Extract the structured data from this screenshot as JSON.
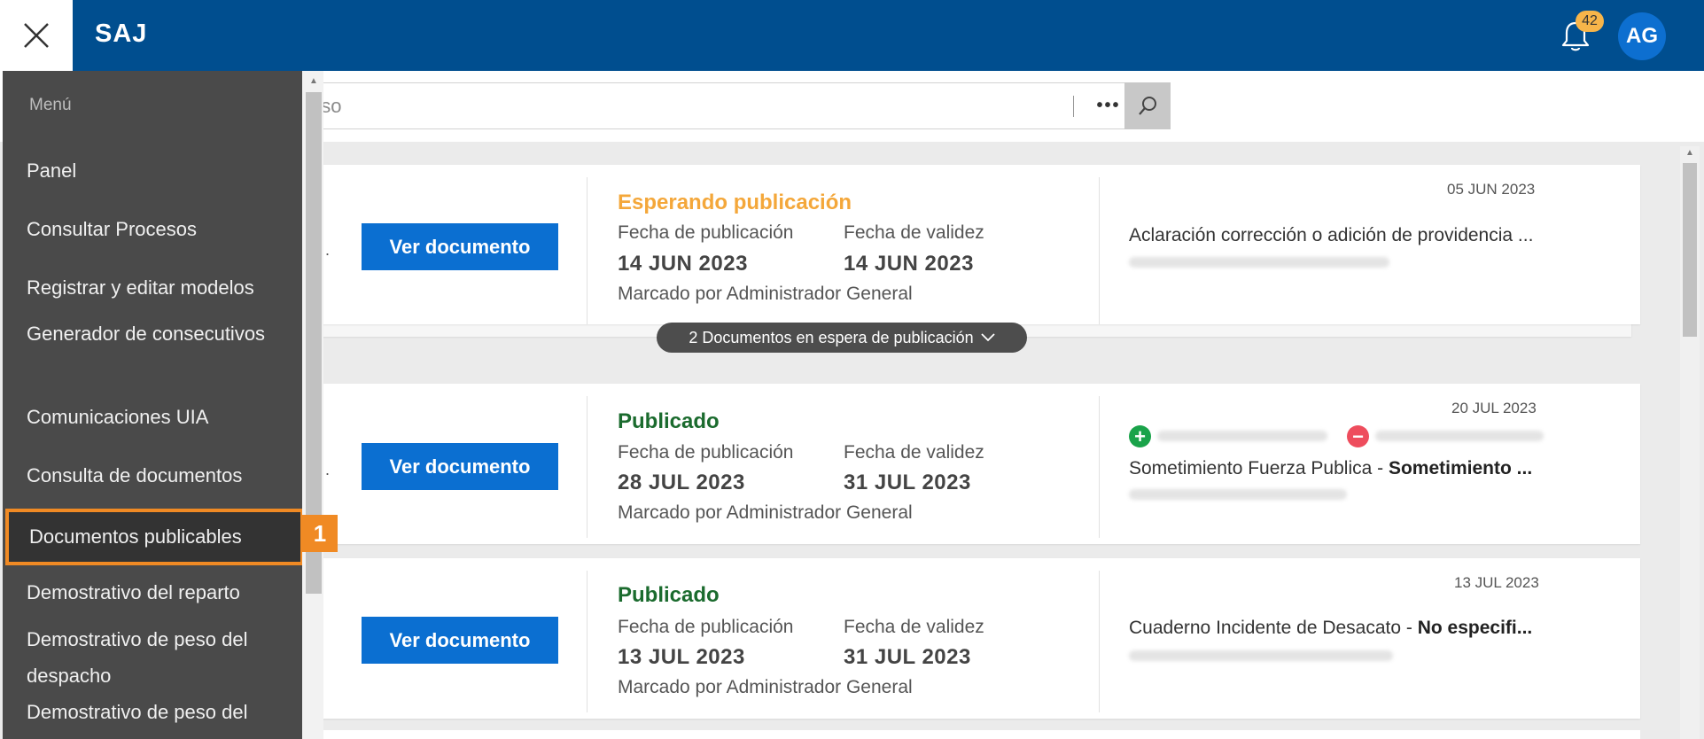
{
  "header": {
    "brand": "SAJ",
    "notifications_count": "42",
    "avatar_initials": "AG",
    "bg_color": "#004e8f"
  },
  "search": {
    "placeholder": "ceso",
    "more_label": "•••"
  },
  "sidebar": {
    "heading": "Menú",
    "items": [
      {
        "label": "Panel"
      },
      {
        "label": "Consultar Procesos"
      },
      {
        "label": "Registrar y editar modelos"
      },
      {
        "label": "Generador de consecutivos"
      },
      {
        "label": "Comunicaciones UIA"
      },
      {
        "label": "Consulta de documentos"
      },
      {
        "label": "Documentos publicables"
      },
      {
        "label": "Demostrativo del reparto"
      },
      {
        "label": "Demostrativo de peso del despacho"
      },
      {
        "label": "Demostrativo de peso del"
      }
    ],
    "active_index": 6,
    "step_badge": "1",
    "highlight_color": "#f08a24"
  },
  "cards": [
    {
      "button": "Ver documento",
      "status": "Esperando publicación",
      "status_color": "#f4a73a",
      "pub_label": "Fecha de publicación",
      "pub_date": "14 JUN 2023",
      "val_label": "Fecha de validez",
      "val_date": "14 JUN 2023",
      "marked": "Marcado por Administrador General",
      "date": "05 JUN 2023",
      "desc_plain": "Aclaración corrección o adición de providencia ...",
      "desc_bold": ""
    },
    {
      "button": "Ver documento",
      "status": "Publicado",
      "status_color": "#1b6b2e",
      "pub_label": "Fecha de publicación",
      "pub_date": "28 JUL 2023",
      "val_label": "Fecha de validez",
      "val_date": "31 JUL 2023",
      "marked": "Marcado por Administrador General",
      "date": "20 JUL 2023",
      "desc_plain": "Sometimiento Fuerza Publica - ",
      "desc_bold": "Sometimiento ...",
      "plus_icon": "+",
      "minus_icon": "−"
    },
    {
      "button": "Ver documento",
      "status": "Publicado",
      "status_color": "#1b6b2e",
      "pub_label": "Fecha de publicación",
      "pub_date": "13 JUL 2023",
      "val_label": "Fecha de validez",
      "val_date": "31 JUL 2023",
      "marked": "Marcado por Administrador General",
      "date": "13 JUL 2023",
      "desc_plain": "Cuaderno Incidente de Desacato - ",
      "desc_bold": "No especifi..."
    }
  ],
  "pending_pill": "2 Documentos en espera de publicación"
}
